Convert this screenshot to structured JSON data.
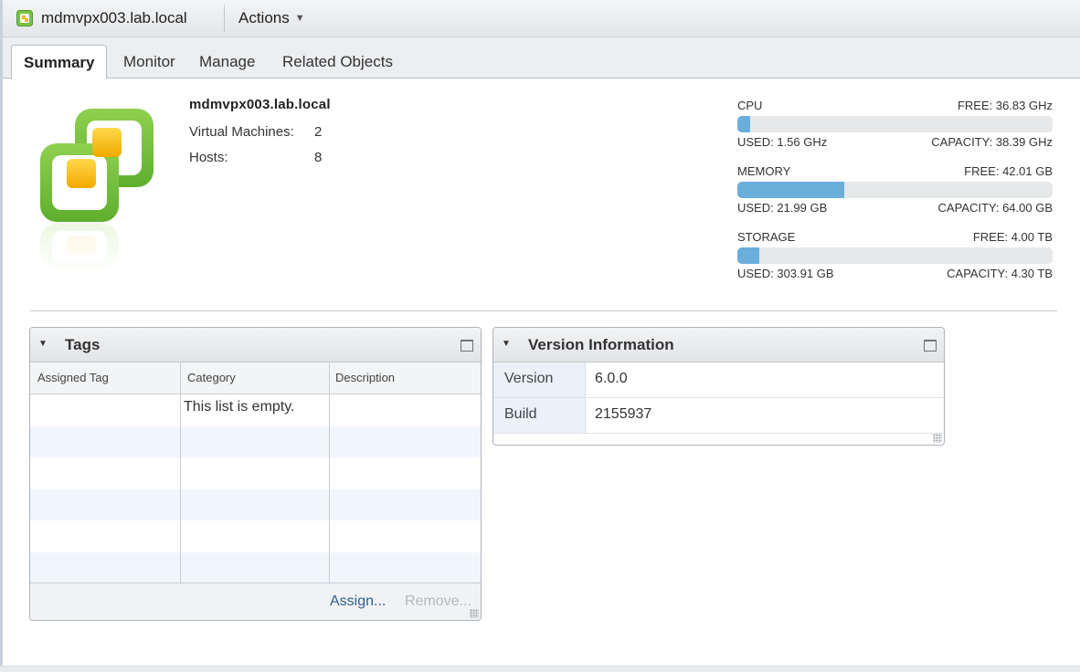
{
  "window": {
    "title": "mdmvpx003.lab.local",
    "actions_label": "Actions"
  },
  "tabs": [
    {
      "label": "Summary",
      "active": true
    },
    {
      "label": "Monitor",
      "active": false
    },
    {
      "label": "Manage",
      "active": false
    },
    {
      "label": "Related Objects",
      "active": false
    }
  ],
  "summary": {
    "name": "mdmvpx003.lab.local",
    "vms_label": "Virtual Machines:",
    "vms_value": "2",
    "hosts_label": "Hosts:",
    "hosts_value": "8"
  },
  "resources": {
    "cpu": {
      "label": "CPU",
      "free": "FREE: 36.83 GHz",
      "used": "USED: 1.56 GHz",
      "capacity": "CAPACITY: 38.39 GHz",
      "used_fraction": 0.04
    },
    "memory": {
      "label": "MEMORY",
      "free": "FREE: 42.01 GB",
      "used": "USED: 21.99 GB",
      "capacity": "CAPACITY: 64.00 GB",
      "used_fraction": 0.34
    },
    "storage": {
      "label": "STORAGE",
      "free": "FREE: 4.00 TB",
      "used": "USED: 303.91 GB",
      "capacity": "CAPACITY: 4.30 TB",
      "used_fraction": 0.07
    },
    "bar_color": "#6aaedc"
  },
  "tags_portlet": {
    "title": "Tags",
    "columns": [
      "Assigned Tag",
      "Category",
      "Description"
    ],
    "empty_message": "This list is empty.",
    "assign_label": "Assign...",
    "remove_label": "Remove..."
  },
  "version_portlet": {
    "title": "Version Information",
    "rows": [
      {
        "key": "Version",
        "value": "6.0.0"
      },
      {
        "key": "Build",
        "value": "2155937"
      }
    ]
  },
  "icons": {
    "title": "vcenter-icon",
    "logo": "vcenter-logo",
    "collapse": "collapse-triangle-icon",
    "maximize": "maximize-icon"
  }
}
